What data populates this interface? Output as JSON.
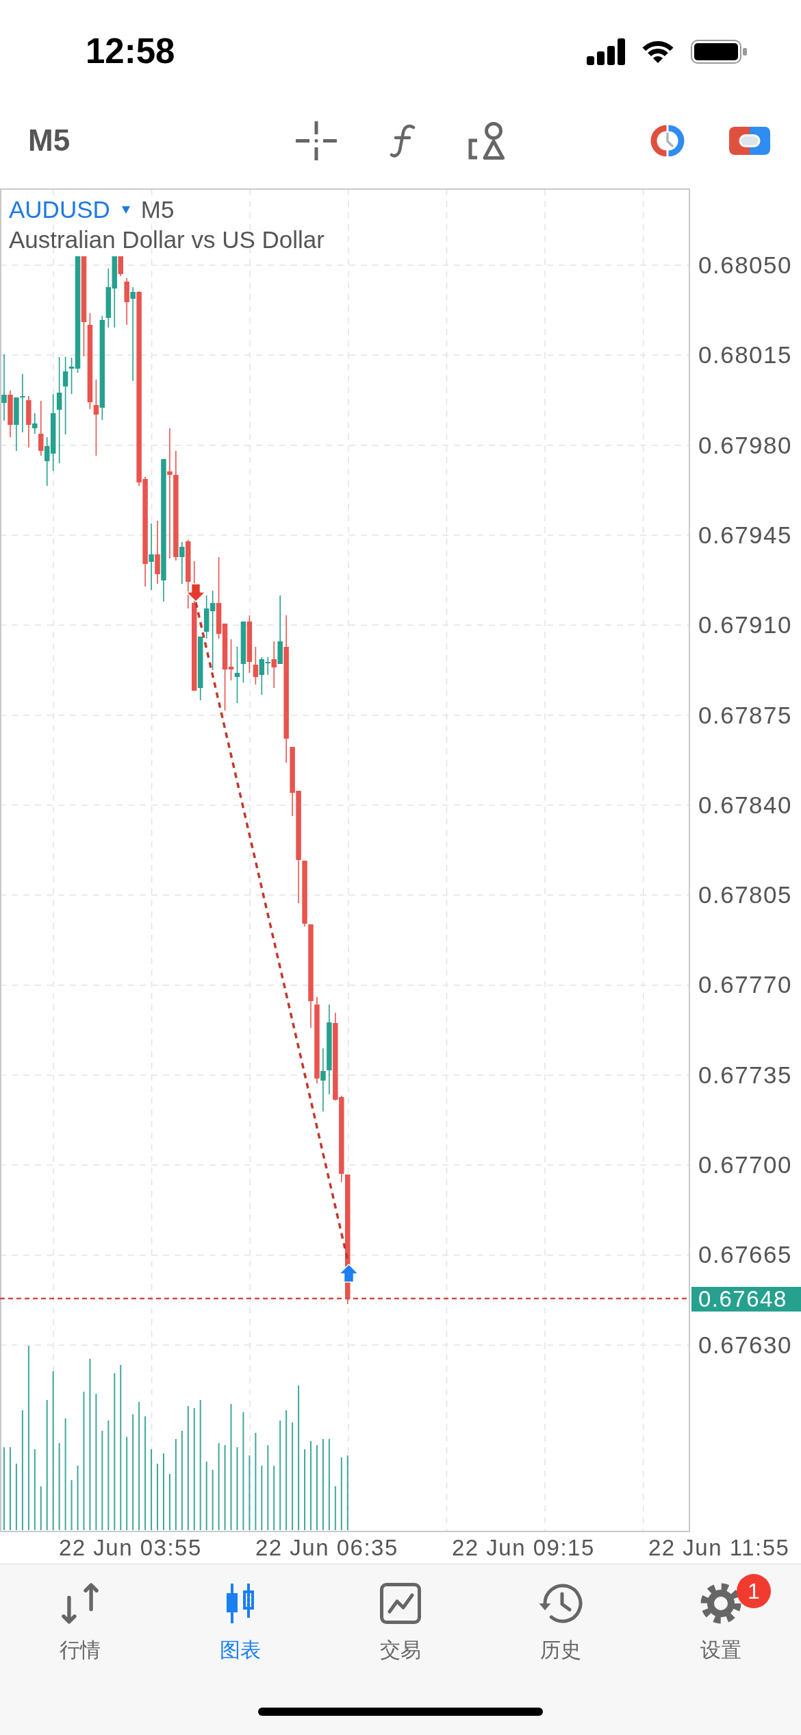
{
  "status_bar": {
    "time": "12:58"
  },
  "toolbar": {
    "timeframe": "M5"
  },
  "chart": {
    "symbol": "AUDUSD",
    "timeframe": "M5",
    "description": "Australian Dollar vs US Dollar",
    "price_labels": [
      "0.68050",
      "0.68015",
      "0.67980",
      "0.67945",
      "0.67910",
      "0.67875",
      "0.67840",
      "0.67805",
      "0.67770",
      "0.67735",
      "0.67700",
      "0.67665",
      "0.67630"
    ],
    "current_price": "0.67648",
    "time_labels": [
      "22 Jun 03:55",
      "22 Jun 06:35",
      "22 Jun 09:15",
      "22 Jun 11:55"
    ]
  },
  "tab_bar": {
    "items": [
      {
        "label": "行情",
        "kind": "quotes",
        "selected": false
      },
      {
        "label": "图表",
        "kind": "chart",
        "selected": true
      },
      {
        "label": "交易",
        "kind": "trade",
        "selected": false
      },
      {
        "label": "历史",
        "kind": "history",
        "selected": false
      },
      {
        "label": "设置",
        "kind": "settings",
        "selected": false,
        "badge": "1"
      }
    ]
  }
}
